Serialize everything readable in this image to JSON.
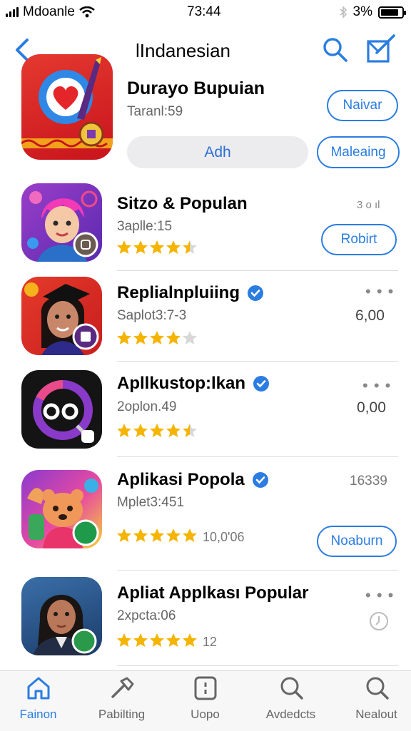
{
  "status_bar": {
    "carrier": "Mdoanle",
    "time": "73:44",
    "battery": "3%",
    "battery_level": 0.85
  },
  "nav": {
    "title": "lIndanesian"
  },
  "featured": {
    "name": "Durayo Bupuian",
    "subtitle": "Taranl:59",
    "button1": "Naivar",
    "button2": "Adh",
    "button3": "Maleaing"
  },
  "apps": [
    {
      "name": "Sitzo & Populan",
      "subtitle": "3aplle:15",
      "rating": 4.5,
      "reviews": "",
      "right": "3 o ıl",
      "button": "Robirt",
      "verified": false
    },
    {
      "name": "Replialnpluiing",
      "subtitle": "Saplot3:7-3",
      "rating": 4,
      "reviews": "",
      "right": "6,00",
      "button": "",
      "verified": true
    },
    {
      "name": "Apllkustop:lkan",
      "subtitle": "2oplon.49",
      "rating": 4.5,
      "reviews": "",
      "right": "0,00",
      "button": "",
      "verified": true
    },
    {
      "name": "Aplikasi Popola",
      "subtitle": "Mplet3:451",
      "rating": 5,
      "reviews": "10,0'06",
      "right": "16339",
      "button": "Noaburn",
      "verified": true
    },
    {
      "name": "Apliat Applkası Popular",
      "subtitle": "2xpcta:06",
      "rating": 5,
      "reviews": "12",
      "right": "",
      "button": "",
      "verified": false
    }
  ],
  "tabs": [
    {
      "label": "Fainon",
      "icon": "home-icon",
      "active": true
    },
    {
      "label": "Pabilting",
      "icon": "hammer-icon",
      "active": false
    },
    {
      "label": "Uopo",
      "icon": "app-square-icon",
      "active": false
    },
    {
      "label": "Avdedcts",
      "icon": "search-icon",
      "active": false
    },
    {
      "label": "Nealout",
      "icon": "search-icon",
      "active": false
    }
  ],
  "colors": {
    "accent": "#2b7de1",
    "star": "#f5b400",
    "verified": "#2b7de1"
  }
}
